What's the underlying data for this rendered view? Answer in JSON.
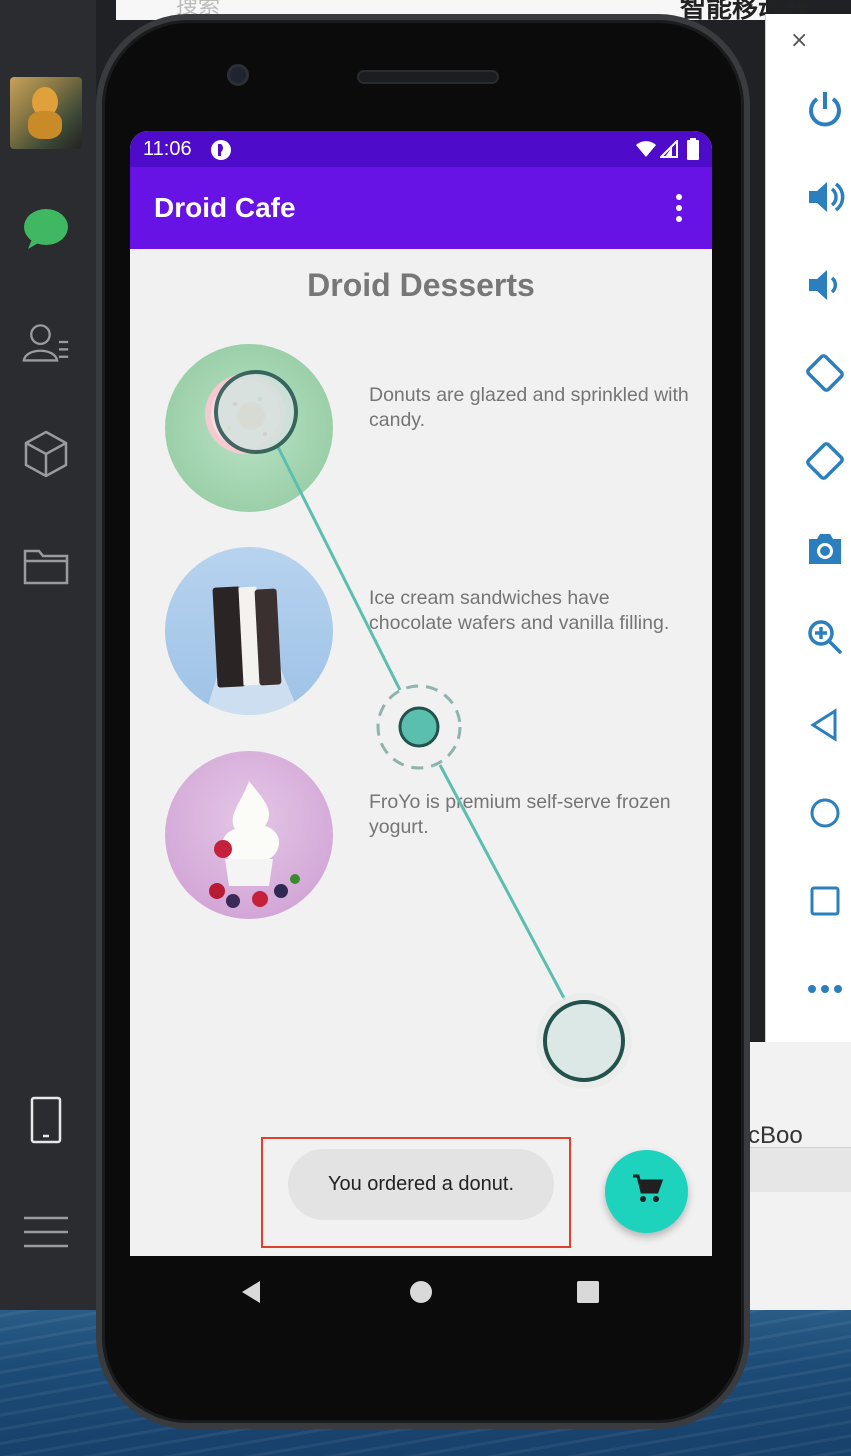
{
  "desktop": {
    "title_fragment": "智能移动开",
    "search_placeholder": "搜索",
    "side_label": "cBoo",
    "close_glyph": "×",
    "left_bar_icons": [
      "avatar",
      "chat-icon",
      "contacts-icon",
      "cube-icon",
      "folder-icon",
      "phone-icon",
      "menu-icon"
    ],
    "emulator_controls": [
      "power-icon",
      "volume-up-icon",
      "volume-down-icon",
      "rotate-left-icon",
      "rotate-right-icon",
      "camera-icon",
      "zoom-icon",
      "back-icon",
      "home-icon",
      "overview-icon",
      "more-icon"
    ]
  },
  "status_bar": {
    "time": "11:06"
  },
  "app_bar": {
    "title": "Droid Cafe"
  },
  "main": {
    "heading": "Droid Desserts",
    "desserts": [
      {
        "name": "donut",
        "description": "Donuts are glazed and sprinkled with candy."
      },
      {
        "name": "ice-cream-sandwich",
        "description": "Ice cream sandwiches have chocolate wafers and vanilla filling."
      },
      {
        "name": "froyo",
        "description": "FroYo is premium self-serve frozen yogurt."
      }
    ]
  },
  "toast": {
    "message": "You ordered a donut."
  },
  "fab": {
    "icon": "cart-icon"
  },
  "colors": {
    "status_bar": "#4e0bc9",
    "app_bar": "#6813e6",
    "fab": "#1ed3bd",
    "gesture": "#5bbfb0"
  }
}
